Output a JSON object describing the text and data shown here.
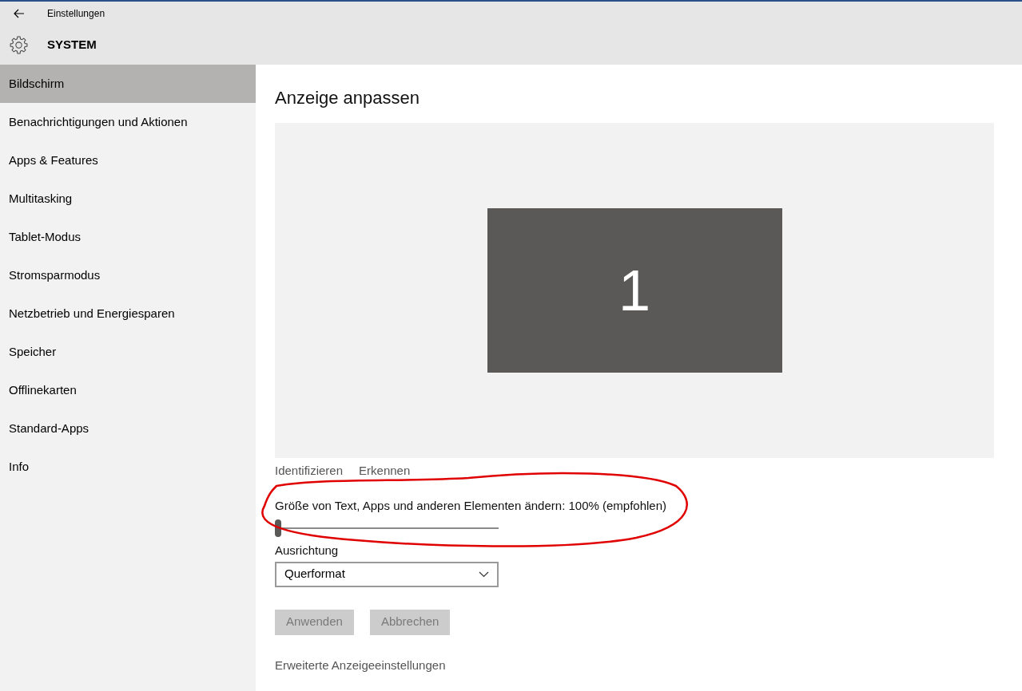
{
  "window": {
    "title": "Einstellungen"
  },
  "header": {
    "title": "SYSTEM"
  },
  "sidebar": {
    "items": [
      {
        "label": "Bildschirm",
        "selected": true
      },
      {
        "label": "Benachrichtigungen und Aktionen",
        "selected": false
      },
      {
        "label": "Apps & Features",
        "selected": false
      },
      {
        "label": "Multitasking",
        "selected": false
      },
      {
        "label": "Tablet-Modus",
        "selected": false
      },
      {
        "label": "Stromsparmodus",
        "selected": false
      },
      {
        "label": "Netzbetrieb und Energiesparen",
        "selected": false
      },
      {
        "label": "Speicher",
        "selected": false
      },
      {
        "label": "Offlinekarten",
        "selected": false
      },
      {
        "label": "Standard-Apps",
        "selected": false
      },
      {
        "label": "Info",
        "selected": false
      }
    ]
  },
  "main": {
    "heading": "Anzeige anpassen",
    "monitor": {
      "number": "1"
    },
    "links": [
      "Identifizieren",
      "Erkennen"
    ],
    "scale": {
      "label": "Größe von Text, Apps und anderen Elementen ändern: 100% (empfohlen)",
      "level": 0
    },
    "orientation": {
      "label": "Ausrichtung",
      "value": "Querformat"
    },
    "buttons": [
      {
        "label": "Anwenden",
        "disabled": true
      },
      {
        "label": "Abbrechen",
        "disabled": true
      }
    ],
    "advanced_link": "Erweiterte Anzeigeeinstellungen"
  }
}
